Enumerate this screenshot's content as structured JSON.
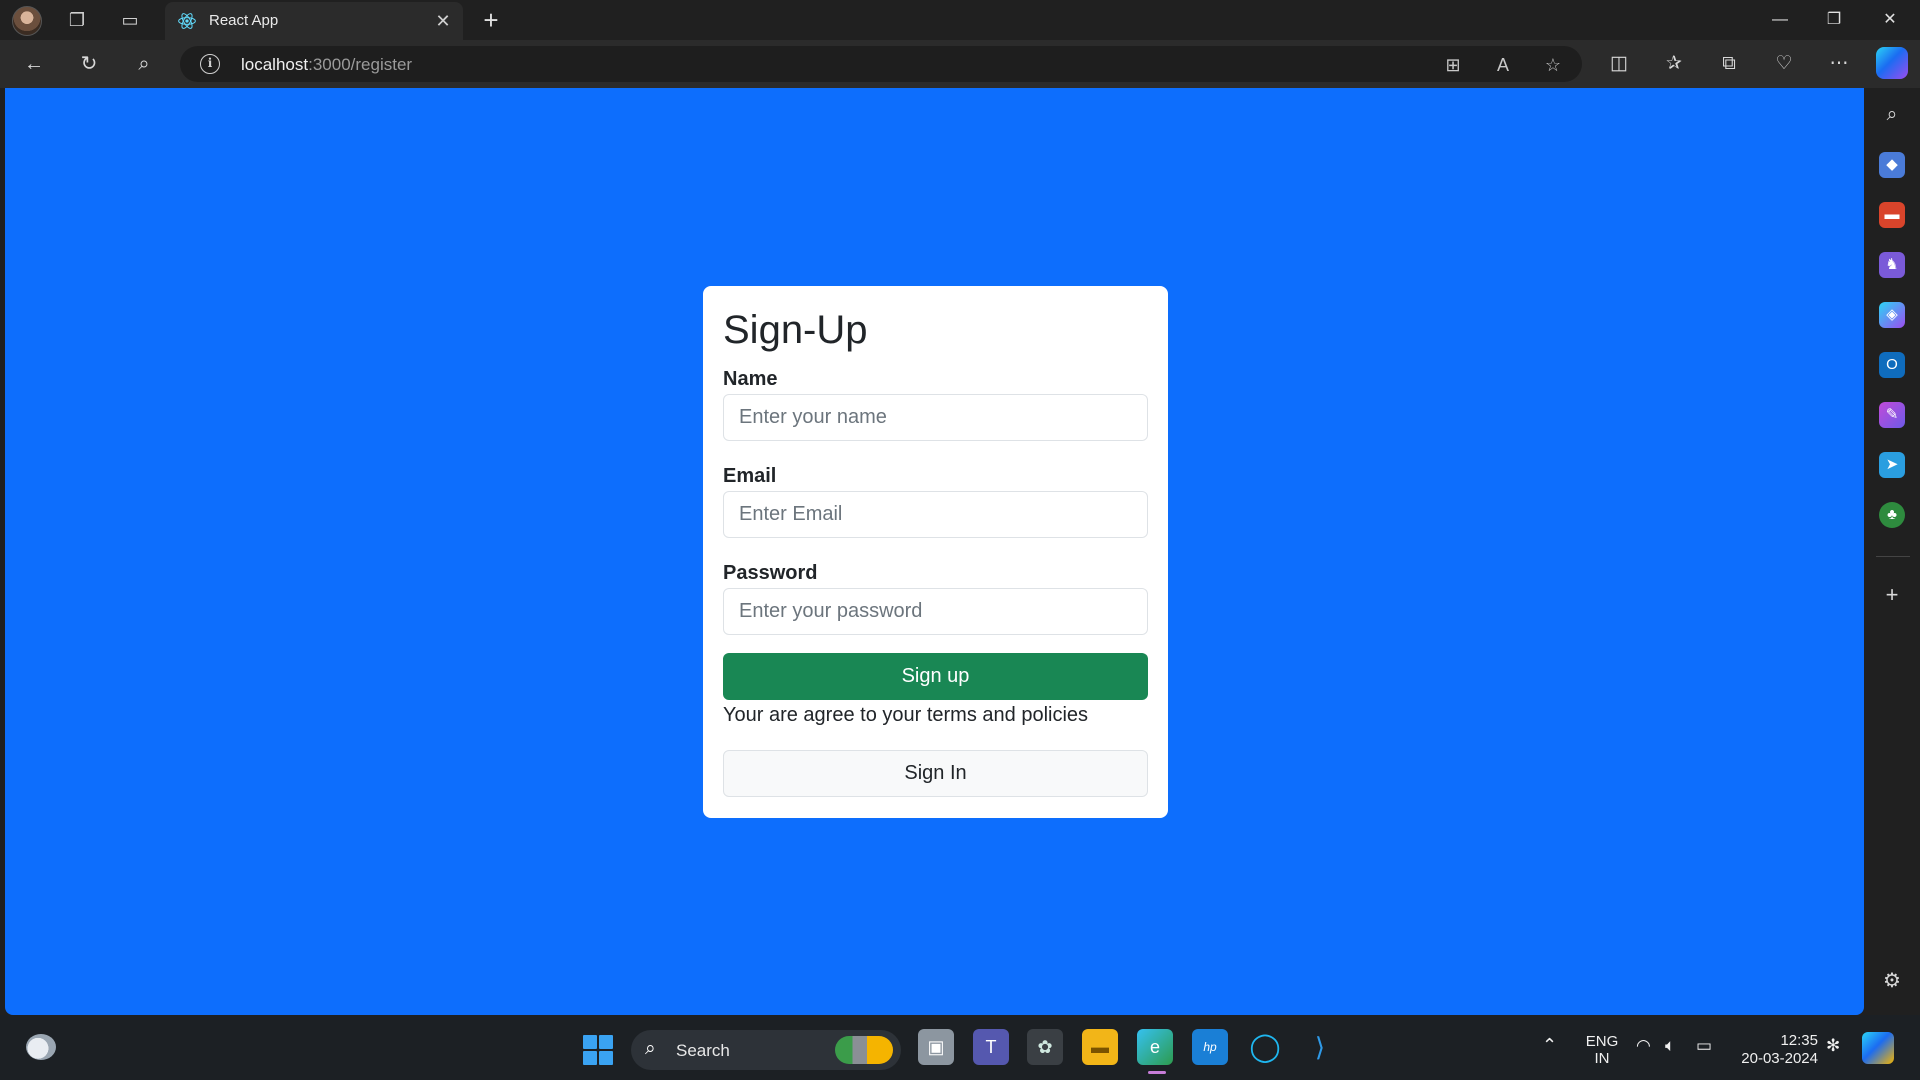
{
  "browser": {
    "tab": {
      "title": "React App"
    },
    "address": {
      "host": "localhost",
      "rest": ":3000/register"
    }
  },
  "form": {
    "title": "Sign-Up",
    "name": {
      "label": "Name",
      "placeholder": "Enter your name"
    },
    "email": {
      "label": "Email",
      "placeholder": "Enter Email"
    },
    "password": {
      "label": "Password",
      "placeholder": "Enter your password"
    },
    "signup_label": "Sign up",
    "terms_text": "Your are agree to your terms and policies",
    "signin_label": "Sign In"
  },
  "colors": {
    "page_background": "#0d6efd",
    "signup_button": "#198754",
    "signin_button": "#f8f9fa"
  },
  "sidebar": {
    "icons": [
      "search-icon",
      "shopping-tag-icon",
      "tools-icon",
      "games-icon",
      "copilot-icon",
      "outlook-icon",
      "designer-icon",
      "send-icon",
      "tree-icon",
      "add-icon",
      "settings-icon"
    ]
  },
  "taskbar": {
    "search_label": "Search",
    "language": {
      "line1": "ENG",
      "line2": "IN"
    },
    "time": "12:35",
    "date": "20-03-2024"
  }
}
